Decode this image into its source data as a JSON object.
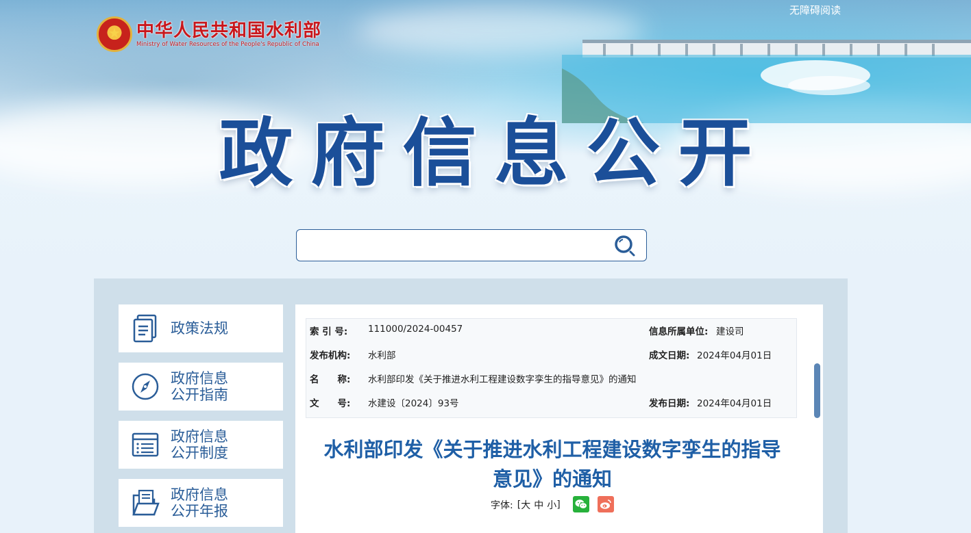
{
  "header": {
    "ministry_cn": "中华人民共和国水利部",
    "ministry_en": "Ministry of Water Resources of the People's Republic of China",
    "accessibility_link": "无障碍阅读",
    "main_title": "政府信息公开"
  },
  "search": {
    "value": "",
    "placeholder": ""
  },
  "sidebar": {
    "items": [
      {
        "label_line1": "政策法规",
        "label_line2": "",
        "icon": "document-stack-icon"
      },
      {
        "label_line1": "政府信息",
        "label_line2": "公开指南",
        "icon": "compass-icon"
      },
      {
        "label_line1": "政府信息",
        "label_line2": "公开制度",
        "icon": "list-board-icon"
      },
      {
        "label_line1": "政府信息",
        "label_line2": "公开年报",
        "icon": "open-folder-icon"
      }
    ]
  },
  "meta": {
    "index_label": "索 引 号:",
    "index_value": "111000/2024-00457",
    "unit_label": "信息所属单位:",
    "unit_value": "建设司",
    "publisher_label": "发布机构:",
    "publisher_value": "水利部",
    "written_date_label": "成文日期:",
    "written_date_value": "2024年04月01日",
    "name_label": "名　　称:",
    "name_value": "水利部印发《关于推进水利工程建设数字孪生的指导意见》的通知",
    "doc_no_label": "文　　号:",
    "doc_no_value": "水建设〔2024〕93号",
    "publish_date_label": "发布日期:",
    "publish_date_value": "2024年04月01日"
  },
  "article": {
    "title_line1": "水利部印发《关于推进水利工程建设数字孪生的指导",
    "title_line2": "意见》的通知",
    "font_label": "字体:",
    "font_open": "[",
    "font_large": "大",
    "font_medium": "中",
    "font_small": "小",
    "font_close": "]"
  },
  "colors": {
    "title_blue": "#1b4f99",
    "link_blue": "#2a5d98",
    "article_title": "#1f5fa6",
    "ministry_red": "#c8171c",
    "wechat_green": "#27b13b",
    "weibo_red": "#ef6f5a"
  }
}
